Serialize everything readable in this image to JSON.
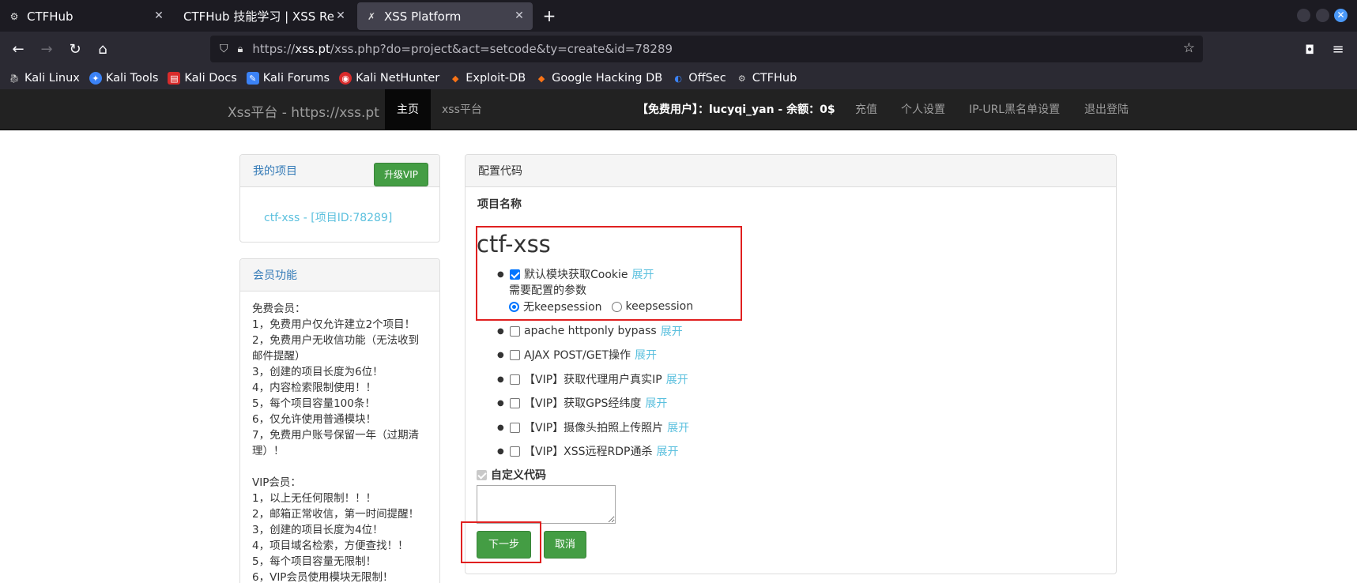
{
  "browser": {
    "tabs": [
      {
        "title": "CTFHub",
        "icon": "ctfhub-icon"
      },
      {
        "title": "CTFHub 技能学习 | XSS Refle",
        "icon": "ctfhub-icon"
      },
      {
        "title": "XSS Platform",
        "icon": "xss-icon",
        "active": true
      }
    ],
    "url_prefix": "https://",
    "url_host": "xss.pt",
    "url_path": "/xss.php?do=project&act=setcode&ty=create&id=78289",
    "bookmarks": [
      {
        "label": "Kali Linux",
        "color": "#cccccc"
      },
      {
        "label": "Kali Tools",
        "color": "#3b82f6"
      },
      {
        "label": "Kali Docs",
        "color": "#d92b2b"
      },
      {
        "label": "Kali Forums",
        "color": "#3b82f6"
      },
      {
        "label": "Kali NetHunter",
        "color": "#d92b2b"
      },
      {
        "label": "Exploit-DB",
        "color": "#f97316"
      },
      {
        "label": "Google Hacking DB",
        "color": "#f97316"
      },
      {
        "label": "OffSec",
        "color": "#3b82f6"
      },
      {
        "label": "CTFHub",
        "color": "#cccccc"
      }
    ]
  },
  "site": {
    "brand": "Xss平台 - https://xss.pt",
    "nav": [
      "主页",
      "xss平台"
    ],
    "user": "【免费用户】：lucyqi_yan - 余额：0$",
    "right_nav": [
      "充值",
      "个人设置",
      "IP-URL黑名单设置",
      "退出登陆"
    ]
  },
  "sidebar": {
    "my_projects_title": "我的项目",
    "upgrade_btn": "升级VIP",
    "project_link": "ctf-xss - [项目ID:78289]",
    "member_title": "会员功能",
    "member_lines": [
      "免费会员：",
      "1，免费用户仅允许建立2个项目！",
      "2，免费用户无收信功能（无法收到",
      "邮件提醒）",
      "3，创建的项目长度为6位！",
      "4，内容检索限制使用！！",
      "5，每个项目容量100条！",
      "6，仅允许使用普通模块！",
      "7，免费用户账号保留一年（过期清",
      "理）！",
      "",
      "VIP会员：",
      "1，以上无任何限制！！！",
      "2，邮箱正常收信，第一时间提醒！",
      "3，创建的项目长度为4位！",
      "4，项目域名检索，方便查找！！",
      "5，每个项目容量无限制！",
      "6，VIP会员使用模块无限制！"
    ]
  },
  "main": {
    "panel_title": "配置代码",
    "project_name_label": "项目名称",
    "project_name": "ctf-xss",
    "default_module": "默认模块获取Cookie",
    "expand": "展开",
    "params_label": "需要配置的参数",
    "radio_options": [
      "无keepsession",
      "keepsession"
    ],
    "modules": [
      "apache httponly bypass",
      "AJAX POST/GET操作",
      "【VIP】获取代理用户真实IP",
      "【VIP】获取GPS经纬度",
      "【VIP】摄像头拍照上传照片",
      "【VIP】XSS远程RDP通杀"
    ],
    "custom_code_label": "自定义代码",
    "next_btn": "下一步",
    "cancel_btn": "取消"
  }
}
